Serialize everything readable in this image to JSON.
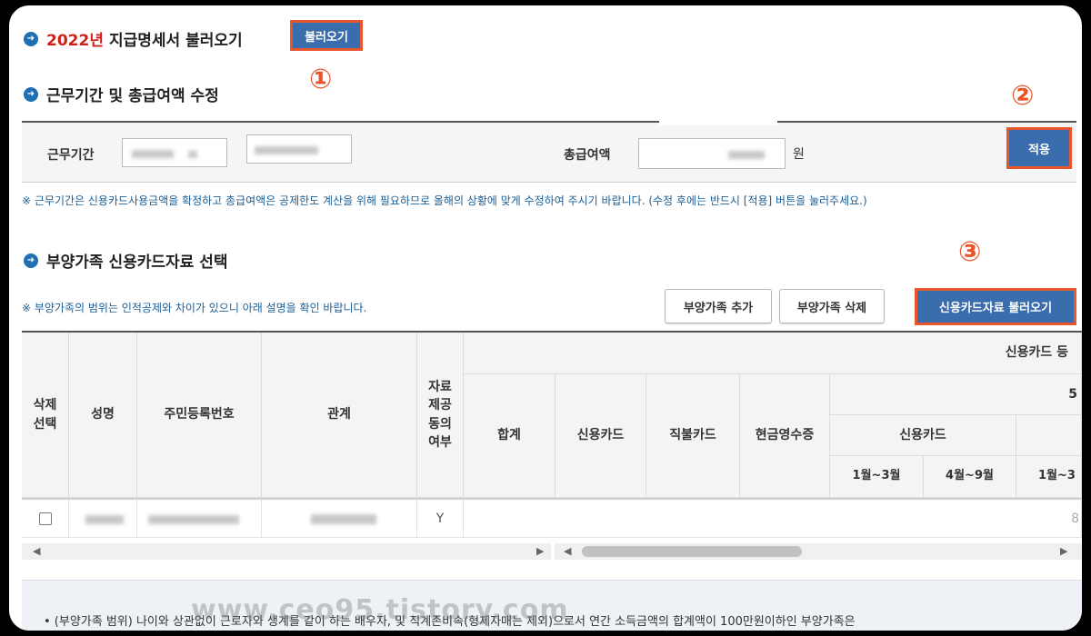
{
  "section1": {
    "year": "2022년",
    "title": "지급명세서 불러오기",
    "load_button": "불러오기",
    "marker": "①"
  },
  "section2": {
    "title": "근무기간 및 총급여액 수정",
    "marker": "②",
    "period_label": "근무기간",
    "salary_label": "총급여액",
    "won": "원",
    "apply_button": "적용",
    "notice": "※ 근무기간은 신용카드사용금액을 확정하고 총급여액은 공제한도 계산을 위해 필요하므로 올해의 상황에 맞게 수정하여 주시기 바랍니다. (수정 후에는 반드시 [적용] 버튼을 눌러주세요.)"
  },
  "section3": {
    "title": "부양가족 신용카드자료 선택",
    "marker": "③",
    "notice": "※ 부양가족의 범위는 인적공제와 차이가 있으니 아래 설명을 확인 바랍니다.",
    "add_button": "부양가족 추가",
    "delete_button": "부양가족 삭제",
    "load_card_button": "신용카드자료 불러오기"
  },
  "table": {
    "headers": {
      "delete_select": "삭제\n선택",
      "name": "성명",
      "rrn": "주민등록번호",
      "relation": "관계",
      "consent": "자료\n제공\n동의\n여부",
      "group": "신용카드 등",
      "sub_group": "5",
      "total": "합계",
      "credit": "신용카드",
      "debit": "직불카드",
      "cash": "현금영수증",
      "credit2": "신용카드",
      "m1_3": "1월~3월",
      "m4_9": "4월~9월",
      "m1_3b": "1월~3"
    },
    "row": {
      "consent": "Y",
      "last_col": "8"
    }
  },
  "bottom": {
    "text": "• (부양가족 범위) 나이와 상관없이 근로자와 생계를 같이 하는 배우자, 및 직계존비속(형제자매는 제외)으로서 연간 소득금액의 합계액이 100만원이하인 부양가족은"
  },
  "watermark": "www.ceo95.tistory.com"
}
